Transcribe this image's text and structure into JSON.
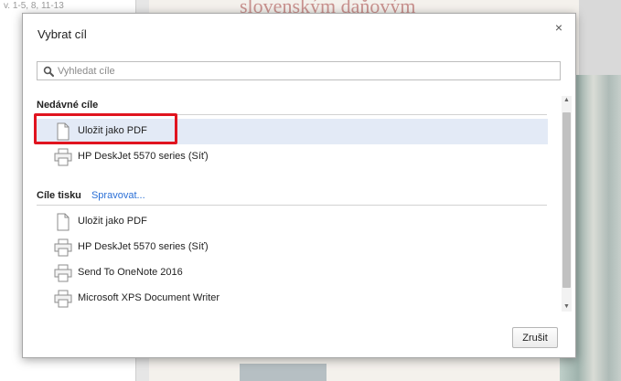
{
  "background": {
    "sidebar_text": "v. 1-5, 8, 11-13",
    "heading_text": "slovenským daňovým"
  },
  "dialog": {
    "title": "Vybrat cíl",
    "close_label": "×",
    "search": {
      "placeholder": "Vyhledat cíle",
      "value": ""
    },
    "recent": {
      "header": "Nedávné cíle",
      "items": [
        {
          "label": "Uložit jako PDF",
          "icon": "document-icon",
          "selected": true
        },
        {
          "label": "HP DeskJet 5570 series (Síť)",
          "icon": "printer-icon",
          "selected": false
        }
      ]
    },
    "print_destinations": {
      "header": "Cíle tisku",
      "manage_link": "Spravovat...",
      "items": [
        {
          "label": "Uložit jako PDF",
          "icon": "document-icon"
        },
        {
          "label": "HP DeskJet 5570 series (Síť)",
          "icon": "printer-icon"
        },
        {
          "label": "Send To OneNote 2016",
          "icon": "printer-icon"
        },
        {
          "label": "Microsoft XPS Document Writer",
          "icon": "printer-icon"
        }
      ]
    },
    "cancel_label": "Zrušit"
  },
  "colors": {
    "selection_bg": "#e3eaf6",
    "link": "#2a6fd6",
    "annotation_red": "#e0141f"
  }
}
